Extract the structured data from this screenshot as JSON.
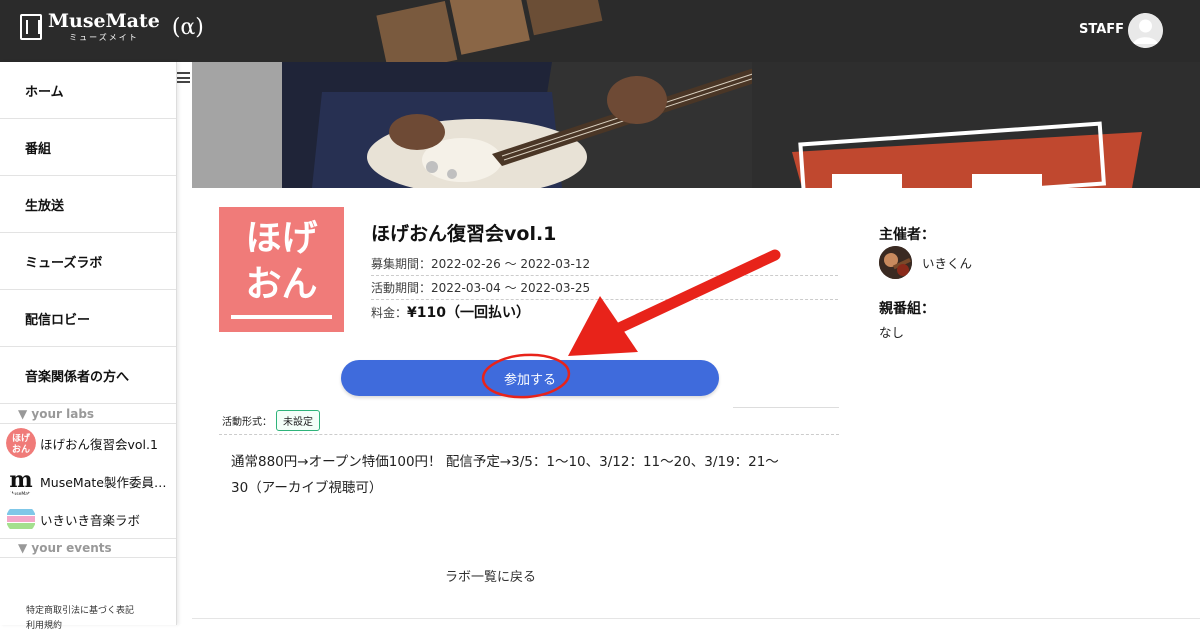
{
  "header": {
    "app_name": "MuseMate",
    "app_sub": "ミューズメイト",
    "alpha": "(α)",
    "user_label": "STAFF"
  },
  "sidebar": {
    "items": [
      {
        "label": "ホーム"
      },
      {
        "label": "番組"
      },
      {
        "label": "生放送"
      },
      {
        "label": "ミューズラボ"
      },
      {
        "label": "配信ロビー"
      },
      {
        "label": "音楽関係者の方へ"
      }
    ],
    "labs_heading": "▼ your labs",
    "labs": [
      {
        "label": "ほげおん復習会vol.1",
        "icon_text": "ほげ おん"
      },
      {
        "label": "MuseMate製作委員…",
        "icon_text": "m",
        "icon_sub": "MuseMate"
      },
      {
        "label": "いきいき音楽ラボ",
        "icon_text": "いきいき音楽ラボ"
      }
    ],
    "events_heading": "▼ your events",
    "footer_links": [
      "特定商取引法に基づく表記",
      "利用規約"
    ]
  },
  "lab": {
    "thumb_line1": "ほげ",
    "thumb_line2": "おん",
    "title": "ほげおん復習会vol.1",
    "recruit_label": "募集期間：",
    "recruit_value": "2022-02-26 〜 2022-03-12",
    "activity_label": "活動期間：",
    "activity_value": "2022-03-04 〜 2022-03-25",
    "price_label": "料金：",
    "price_value": "¥110（一回払い）",
    "join_button": "参加する",
    "format_label": "活動形式：",
    "format_value": "未設定",
    "description_line1": "通常880円→オープン特価100円！ 配信予定→3/5：1〜10、3/12：11〜20、3/19：21〜",
    "description_line2": "30（アーカイブ視聴可）",
    "back_link": "ラボ一覧に戻る"
  },
  "side": {
    "host_heading": "主催者：",
    "host_name": "いきくん",
    "parent_heading": "親番組：",
    "parent_value": "なし"
  },
  "colors": {
    "header_bg": "#2b2b2b",
    "thumb_bg": "#f07b79",
    "join_button": "#3f6bdc",
    "annotation_red": "#e8231a",
    "badge_border": "#2eb37a"
  }
}
